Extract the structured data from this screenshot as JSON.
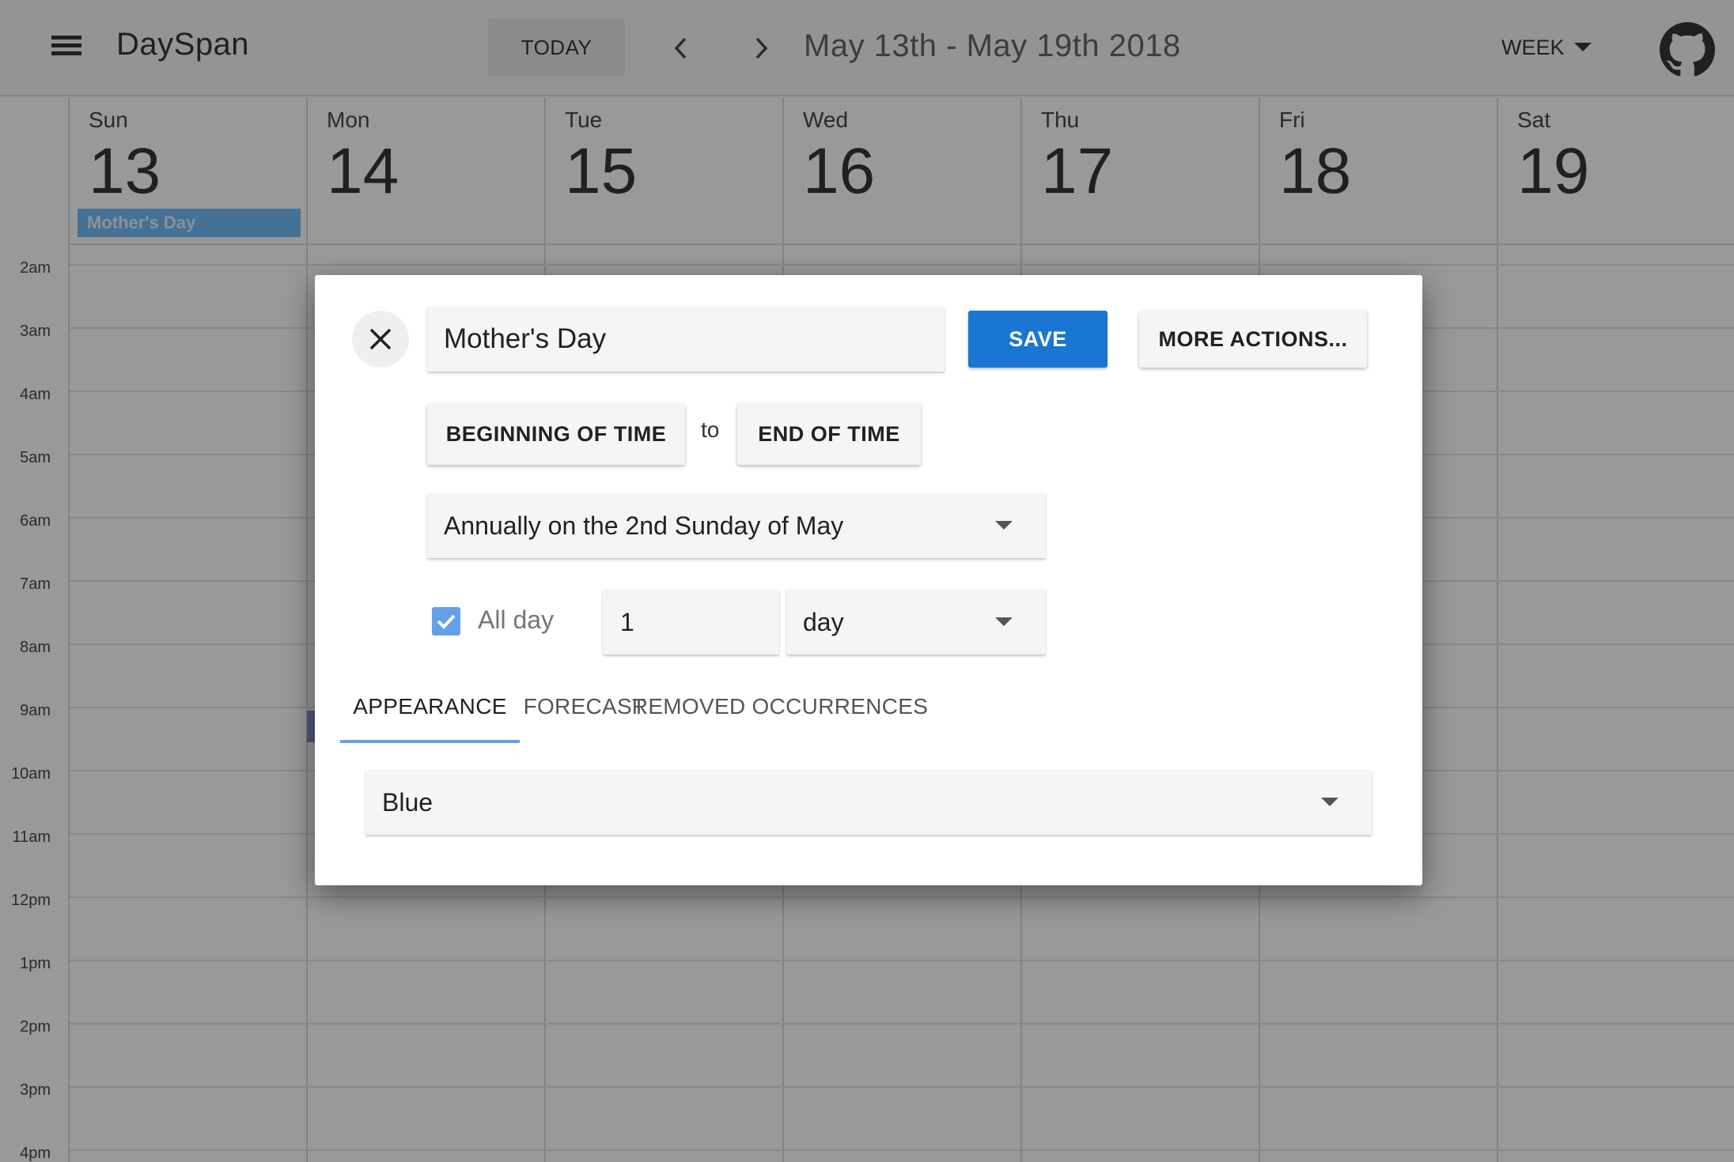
{
  "app": {
    "brand": "DaySpan",
    "today_label": "TODAY",
    "range_title": "May 13th - May 19th 2018",
    "view_label": "WEEK"
  },
  "week": {
    "days": [
      {
        "dow": "Sun",
        "num": "13"
      },
      {
        "dow": "Mon",
        "num": "14"
      },
      {
        "dow": "Tue",
        "num": "15"
      },
      {
        "dow": "Wed",
        "num": "16"
      },
      {
        "dow": "Thu",
        "num": "17"
      },
      {
        "dow": "Fri",
        "num": "18"
      },
      {
        "dow": "Sat",
        "num": "19"
      }
    ],
    "allday_event": "Mother's Day",
    "hours": [
      "2am",
      "3am",
      "4am",
      "5am",
      "6am",
      "7am",
      "8am",
      "9am",
      "10am",
      "11am",
      "12pm",
      "1pm",
      "2pm",
      "3pm",
      "4pm"
    ]
  },
  "dialog": {
    "title_value": "Mother's Day",
    "save_label": "SAVE",
    "more_label": "MORE ACTIONS...",
    "start_label": "BEGINNING OF TIME",
    "to_label": "to",
    "end_label": "END OF TIME",
    "recurrence_value": "Annually on the 2nd Sunday of May",
    "allday_label": "All day",
    "allday_checked": true,
    "duration_value": "1",
    "duration_unit": "day",
    "tabs": [
      "APPEARANCE",
      "FORECAST",
      "REMOVED OCCURRENCES"
    ],
    "active_tab": "APPEARANCE",
    "color_value": "Blue"
  },
  "colors": {
    "primary": "#1976d2",
    "accent": "#64a0ea",
    "event": "#64b5f6"
  },
  "icons": {
    "menu": "menu-icon",
    "prev": "chevron-left-icon",
    "next": "chevron-right-icon",
    "view_caret": "caret-down-icon",
    "github": "github-icon",
    "close": "close-icon",
    "check": "check-icon"
  }
}
